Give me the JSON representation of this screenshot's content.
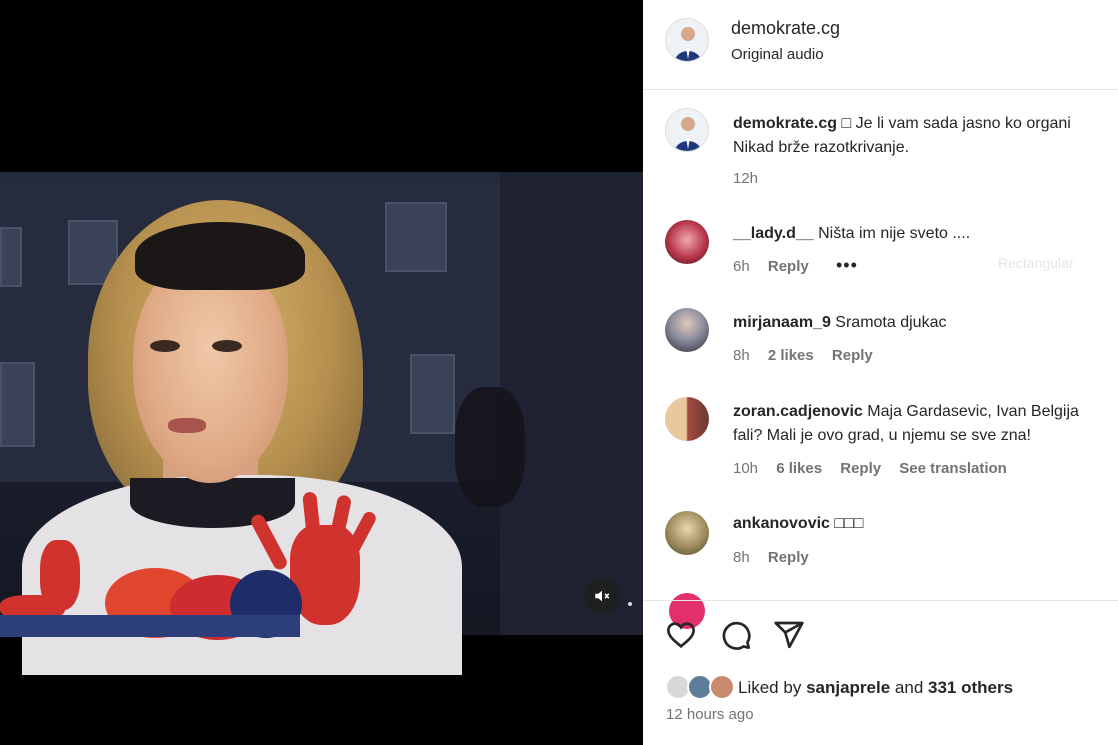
{
  "post_header": {
    "username": "demokrate.cg",
    "audio": "Original audio"
  },
  "caption": {
    "username": "demokrate.cg",
    "line1": "□ Je li vam sada jasno ko organi",
    "line2": "Nikad brže razotkrivanje.",
    "time": "12h"
  },
  "comments": [
    {
      "username": "__lady.d__",
      "text": "Ništa im nije sveto ....",
      "time": "6h",
      "likes": "",
      "reply": "Reply",
      "extra": ""
    },
    {
      "username": "mirjanaam_9",
      "text": "Sramota djukac",
      "time": "8h",
      "likes": "2 likes",
      "reply": "Reply",
      "extra": ""
    },
    {
      "username": "zoran.cadjenovic",
      "text": "Maja Gardasevic, Ivan Belgija",
      "text2": "fali? Mali je ovo grad, u njemu se sve zna!",
      "time": "10h",
      "likes": "6 likes",
      "reply": "Reply",
      "extra": "See translation"
    },
    {
      "username": "ankanovovic",
      "text": "□□□",
      "time": "8h",
      "likes": "",
      "reply": "Reply",
      "extra": ""
    }
  ],
  "overlay": {
    "more": "•••",
    "ghost": "Rectangular"
  },
  "actions": {
    "icons": [
      "heart-icon",
      "comment-icon",
      "share-icon"
    ]
  },
  "likes": {
    "prefix": "Liked by",
    "user": "sanjaprele",
    "middle": "and",
    "others": "331 others",
    "time_ago": "12 hours ago"
  },
  "colors": {
    "text": "#262626",
    "secondary": "#737373",
    "divider": "#e5e5e5",
    "accent": "#d0322e"
  }
}
